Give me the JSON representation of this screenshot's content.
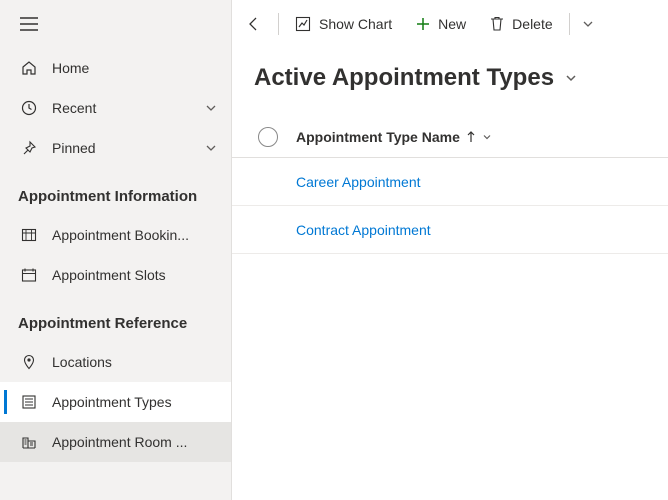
{
  "sidebar": {
    "topItems": [
      {
        "label": "Home"
      },
      {
        "label": "Recent"
      },
      {
        "label": "Pinned"
      }
    ],
    "sections": [
      {
        "title": "Appointment Information",
        "items": [
          {
            "label": "Appointment Bookin..."
          },
          {
            "label": "Appointment Slots"
          }
        ]
      },
      {
        "title": "Appointment Reference",
        "items": [
          {
            "label": "Locations"
          },
          {
            "label": "Appointment Types"
          },
          {
            "label": "Appointment Room ..."
          }
        ]
      }
    ]
  },
  "commandBar": {
    "showChart": "Show Chart",
    "new": "New",
    "delete": "Delete"
  },
  "view": {
    "title": "Active Appointment Types",
    "columnHeader": "Appointment Type Name",
    "rows": [
      {
        "name": "Career Appointment"
      },
      {
        "name": "Contract Appointment"
      }
    ]
  }
}
